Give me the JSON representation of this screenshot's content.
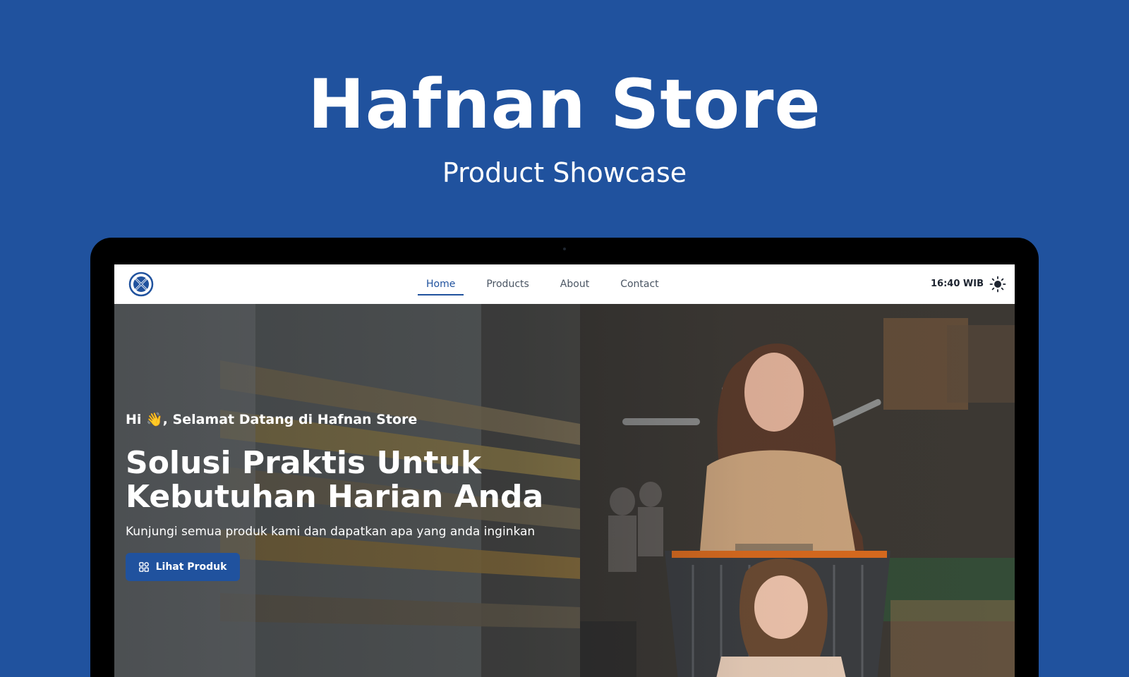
{
  "title": "Hafnan Store",
  "subtitle": "Product Showcase",
  "nav": {
    "items": [
      {
        "label": "Home",
        "active": true
      },
      {
        "label": "Products",
        "active": false
      },
      {
        "label": "About",
        "active": false
      },
      {
        "label": "Contact",
        "active": false
      }
    ],
    "clock": "16:40 WIB",
    "theme_icon": "sun-icon",
    "logo_icon": "store-logo-icon"
  },
  "hero": {
    "greeting": "Hi 👋, Selamat Datang di Hafnan Store",
    "title_line1": "Solusi Praktis Untuk",
    "title_line2": "Kebutuhan Harian Anda",
    "subtitle": "Kunjungi semua produk kami dan dapatkan apa yang anda inginkan",
    "cta_label": "Lihat Produk",
    "cta_icon": "grid-icon"
  },
  "colors": {
    "brand": "#20529e",
    "page_background": "#20529e",
    "nav_text": "#4a5563",
    "device_frame": "#000000"
  }
}
